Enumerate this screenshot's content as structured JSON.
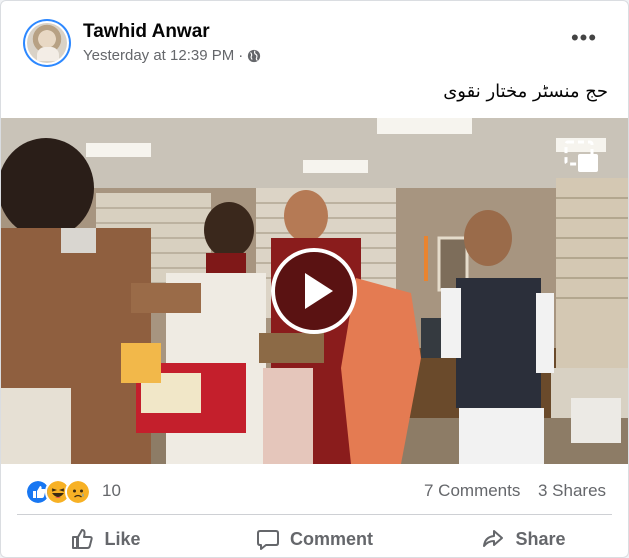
{
  "post": {
    "author": "Tawhid Anwar",
    "timestamp": "Yesterday at 12:39 PM",
    "separator": "·",
    "privacy_icon": "globe-icon",
    "caption": "حج منسٹر مختار نقوی",
    "more_label": "•••"
  },
  "video": {
    "play_icon": "play-icon",
    "pip_icon": "picture-in-picture-icon"
  },
  "stats": {
    "reaction_icons": [
      "like-reaction-icon",
      "haha-reaction-icon",
      "sad-reaction-icon"
    ],
    "reaction_count": "10",
    "comments": "7 Comments",
    "shares": "3 Shares"
  },
  "actions": {
    "like": "Like",
    "comment": "Comment",
    "share": "Share"
  },
  "colors": {
    "accent": "#1877f2",
    "secondary_text": "#65676b",
    "divider": "#ced0d4"
  }
}
